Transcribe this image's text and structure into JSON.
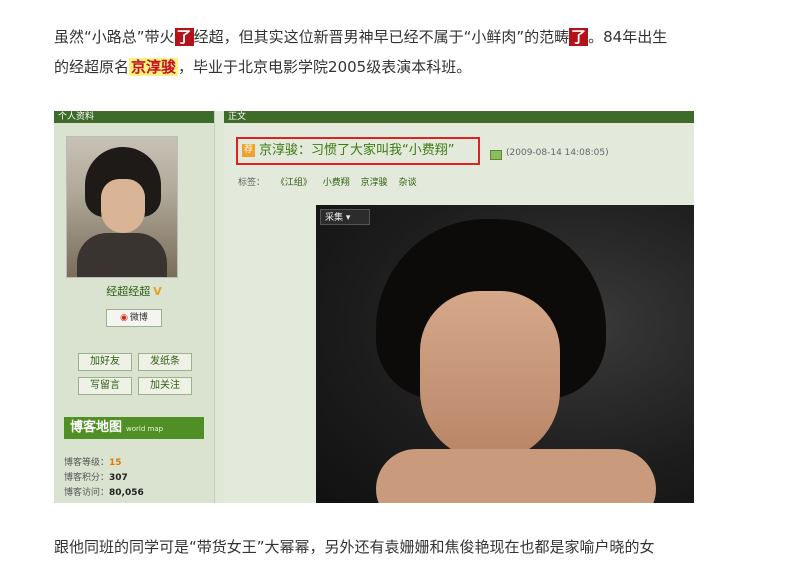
{
  "article": {
    "para1_a": "虽然“小路总”带火",
    "para1_hl1": "了",
    "para1_b": "经超，但其实这位新晋男神早已经不属于“小鲜肉”的范畴",
    "para1_hl2": "了",
    "para1_c": "。84年出生",
    "para2_a": "的经超原名",
    "para2_hl": "京淳骏",
    "para2_b": "，毕业于北京电影学院2005级表演本科班。",
    "para3": "跟他同班的同学可是“带货女王”大幂幂，另外还有袁姗姗和焦俊艳现在也都是家喻户晓的女"
  },
  "blog": {
    "left_header": "个人资料",
    "right_header": "正文",
    "nickname": "经超经超",
    "weibo_label": "微博",
    "buttons": [
      "加好友",
      "发纸条",
      "写留言",
      "加关注"
    ],
    "map_title": "博客地图",
    "map_sub": "world map",
    "stats": [
      {
        "label": "博客等级：",
        "value": "15"
      },
      {
        "label": "博客积分：",
        "value": "307"
      },
      {
        "label": "博客访问：",
        "value": "80,056"
      }
    ],
    "post": {
      "rec_badge": "荐",
      "title": "京淳骏：习惯了大家叫我“小费翔”",
      "time": "(2009-08-14 14:08:05)",
      "tags_label": "标签：",
      "tags": [
        "《江组》",
        "小费翔",
        "京淳骏",
        "杂谈"
      ]
    },
    "collect_label": "采集 ▾"
  },
  "colors": {
    "red_highlight": "#b3121b",
    "yellow_highlight": "#fff27a",
    "blog_green": "#3f6b2a",
    "title_border": "#dd2222"
  }
}
